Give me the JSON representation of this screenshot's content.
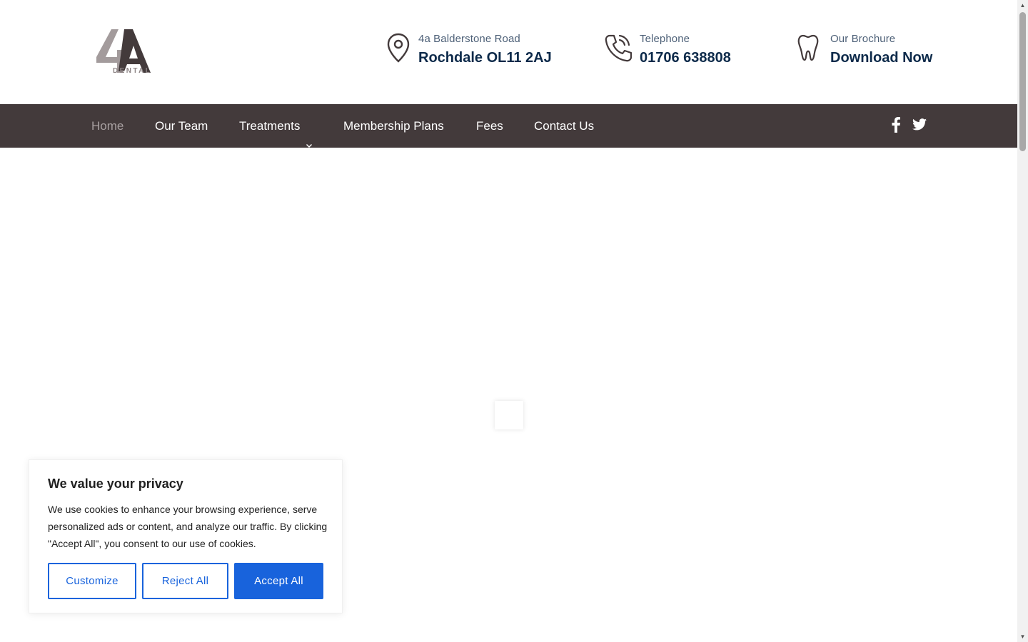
{
  "brand": {
    "logo_text": "4A",
    "logo_subtext": "DENTAL"
  },
  "header": {
    "address": {
      "label": "4a Balderstone Road",
      "value": "Rochdale OL11 2AJ",
      "icon": "location-pin-icon"
    },
    "phone": {
      "label": "Telephone",
      "value": "01706 638808",
      "icon": "phone-icon"
    },
    "brochure": {
      "label": "Our Brochure",
      "value": "Download Now",
      "icon": "tooth-icon"
    }
  },
  "nav": {
    "items": [
      {
        "label": "Home",
        "active": true
      },
      {
        "label": "Our Team"
      },
      {
        "label": "Treatments",
        "has_dropdown": true
      },
      {
        "label": "Membership Plans"
      },
      {
        "label": "Fees"
      },
      {
        "label": "Contact Us"
      }
    ],
    "social": [
      "facebook-icon",
      "twitter-icon"
    ]
  },
  "cookie_banner": {
    "title": "We value your privacy",
    "text": "We use cookies to enhance your browsing experience, serve personalized ads or content, and analyze our traffic. By clicking \"Accept All\", you consent to our use of cookies.",
    "customize_label": "Customize",
    "reject_label": "Reject All",
    "accept_label": "Accept All"
  },
  "colors": {
    "nav_bg": "#433a3b",
    "nav_active": "#a8a0a1",
    "heading_dark": "#0d2a4a",
    "label_muted": "#4e6178",
    "accent_blue": "#1863dc"
  }
}
